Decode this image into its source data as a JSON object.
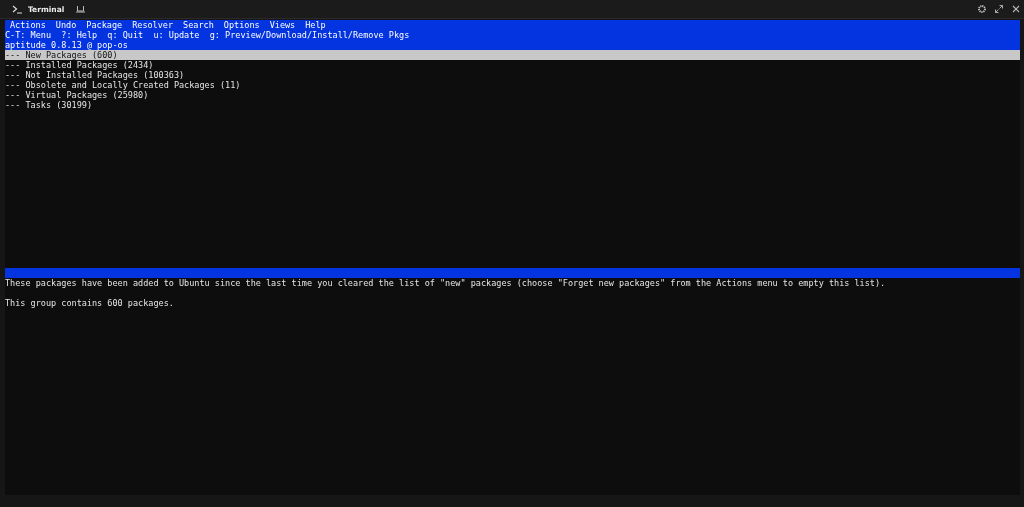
{
  "window": {
    "title": "Terminal"
  },
  "menu": [
    "Actions",
    "Undo",
    "Package",
    "Resolver",
    "Search",
    "Options",
    "Views",
    "Help"
  ],
  "hint_line": "C-T: Menu  ?: Help  q: Quit  u: Update  g: Preview/Download/Install/Remove Pkgs",
  "status_line": "aptitude 0.8.13 @ pop-os",
  "groups": [
    {
      "label": "--- New Packages (600)",
      "selected": true
    },
    {
      "label": "--- Installed Packages (2434)",
      "selected": false
    },
    {
      "label": "--- Not Installed Packages (100363)",
      "selected": false
    },
    {
      "label": "--- Obsolete and Locally Created Packages (11)",
      "selected": false
    },
    {
      "label": "--- Virtual Packages (25980)",
      "selected": false
    },
    {
      "label": "--- Tasks (30199)",
      "selected": false
    }
  ],
  "description": [
    "These packages have been added to Ubuntu since the last time you cleared the list of \"new\" packages (choose \"Forget new packages\" from the Actions menu to empty this list).",
    "This group contains 600 packages."
  ]
}
